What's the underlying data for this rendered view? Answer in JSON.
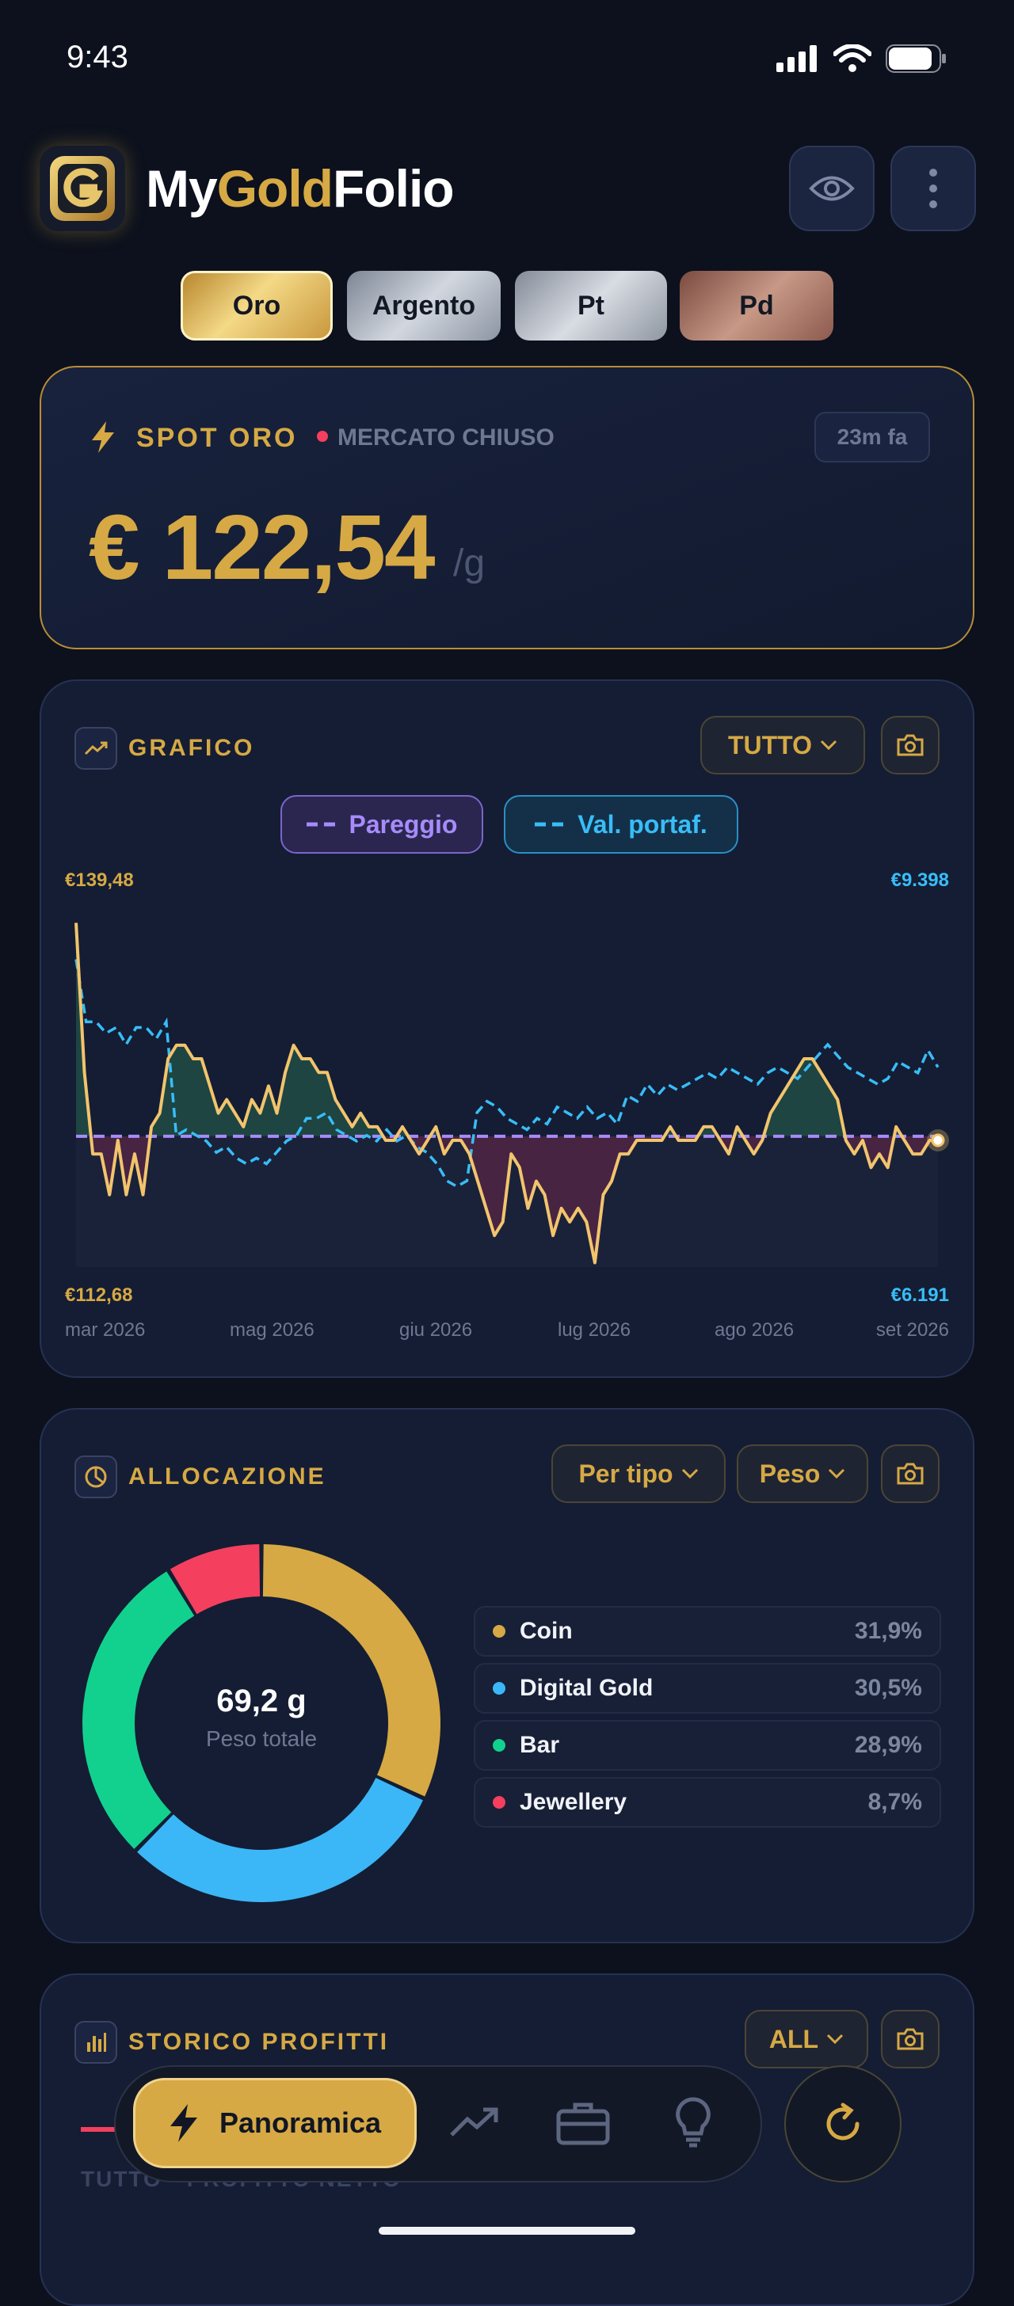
{
  "status": {
    "time": "9:43"
  },
  "app": {
    "brand_part1": "My",
    "brand_part2": "Gold",
    "brand_part3": "Folio"
  },
  "metals": [
    "Oro",
    "Argento",
    "Pt",
    "Pd"
  ],
  "spot": {
    "title": "SPOT ORO",
    "market_status": "MERCATO CHIUSO",
    "updated": "23m fa",
    "price": "€ 122,54",
    "unit": "/g"
  },
  "chart_section": {
    "title": "GRAFICO",
    "range": "TUTTO",
    "toggle_breakeven": "Pareggio",
    "toggle_portfolio": "Val. portaf.",
    "chart_data": {
      "type": "line",
      "x_ticks": [
        "mar 2026",
        "mag 2026",
        "giu 2026",
        "lug 2026",
        "ago 2026",
        "set 2026"
      ],
      "left_axis": {
        "max_label": "€139,48",
        "min_label": "€112,68",
        "ylim": [
          112.68,
          139.48
        ]
      },
      "right_axis": {
        "max_label": "€9.398",
        "min_label": "€6.191",
        "ylim": [
          6191,
          9398
        ]
      },
      "breakeven": 122.3,
      "series": [
        {
          "values": [
            138,
            127,
            121,
            121,
            118,
            122,
            118,
            121,
            118,
            123,
            124,
            128,
            129,
            129,
            128,
            128,
            126,
            124,
            125,
            124,
            123,
            125,
            124,
            126,
            124,
            127,
            129,
            128,
            128,
            127,
            127,
            125,
            124,
            123,
            124,
            123,
            123,
            122,
            122,
            123,
            122,
            121,
            122,
            123,
            121,
            122,
            122,
            121,
            119,
            117,
            115,
            116,
            121,
            120,
            117,
            119,
            118,
            115,
            117,
            116,
            117,
            116,
            113,
            118,
            119,
            121,
            121,
            122,
            122,
            122,
            122,
            123,
            122,
            122,
            122,
            123,
            123,
            122,
            121,
            123,
            122,
            121,
            122,
            124,
            125,
            126,
            127,
            128,
            128,
            127,
            126,
            125,
            122,
            121,
            122,
            120,
            121,
            120,
            123,
            122,
            121,
            121,
            122,
            122
          ]
        },
        {
          "values": [
            8900,
            8350,
            8350,
            8250,
            8300,
            8150,
            8300,
            8300,
            8200,
            8350,
            7350,
            7400,
            7350,
            7300,
            7200,
            7250,
            7150,
            7100,
            7150,
            7100,
            7200,
            7300,
            7350,
            7500,
            7500,
            7550,
            7400,
            7350,
            7300,
            7350,
            7300,
            7400,
            7300,
            7350,
            7250,
            7200,
            7100,
            6950,
            6900,
            6950,
            7550,
            7650,
            7600,
            7500,
            7450,
            7400,
            7500,
            7450,
            7600,
            7550,
            7500,
            7600,
            7500,
            7550,
            7450,
            7700,
            7650,
            7800,
            7700,
            7800,
            7750,
            7800,
            7850,
            7900,
            7850,
            7950,
            7900,
            7850,
            7800,
            7900,
            7950,
            7900,
            7850,
            7950,
            8050,
            8150,
            8050,
            7950,
            7900,
            7850,
            7800,
            7850,
            8000,
            7950,
            7900,
            8100,
            7950
          ]
        }
      ]
    }
  },
  "allocation": {
    "title": "ALLOCAZIONE",
    "filter_type": "Per tipo",
    "filter_measure": "Peso",
    "total_value": "69,2 g",
    "total_label": "Peso totale",
    "chart_data": {
      "type": "pie",
      "slices": [
        {
          "label": "Coin",
          "value": 31.9,
          "pct": "31,9%",
          "color": "#d6a944"
        },
        {
          "label": "Digital Gold",
          "value": 30.5,
          "pct": "30,5%",
          "color": "#3bb7f7"
        },
        {
          "label": "Bar",
          "value": 28.9,
          "pct": "28,9%",
          "color": "#12d18e"
        },
        {
          "label": "Jewellery",
          "value": 8.7,
          "pct": "8,7%",
          "color": "#f43f5e"
        }
      ]
    }
  },
  "profits": {
    "title": "STORICO PROFITTI",
    "range": "ALL",
    "subtitle": "TUTTO · PROFITTO NETTO"
  },
  "nav": {
    "active": "Panoramica"
  },
  "colors": {
    "accent": "#d6a944",
    "card": "#141d33",
    "background": "#0c111d",
    "breakeven": "#a78bfa",
    "portfolio": "#38bdf8"
  }
}
